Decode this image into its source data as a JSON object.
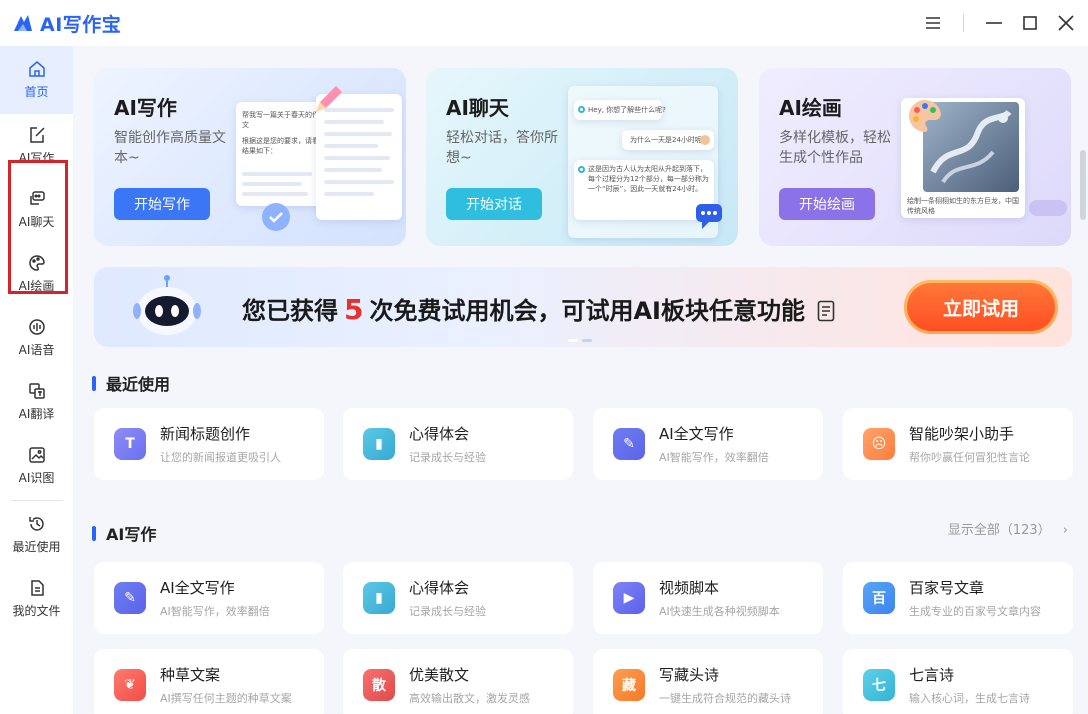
{
  "app": {
    "title": "AI写作宝"
  },
  "sidebar": {
    "items": [
      {
        "label": "首页"
      },
      {
        "label": "AI写作"
      },
      {
        "label": "AI聊天"
      },
      {
        "label": "AI绘画"
      },
      {
        "label": "AI语音"
      },
      {
        "label": "AI翻译"
      },
      {
        "label": "AI识图"
      },
      {
        "label": "最近使用"
      },
      {
        "label": "我的文件"
      }
    ]
  },
  "feature_cards": [
    {
      "title": "AI写作",
      "desc": "智能创作高质量文本~",
      "button": "开始写作",
      "mock_text_1": "帮我写一篇关于春天的作文",
      "mock_text_2": "根据这是您的要求，请看结果如下："
    },
    {
      "title": "AI聊天",
      "desc": "轻松对话，答你所想~",
      "button": "开始对话",
      "bubble_1": "Hey, 你想了解些什么呢?",
      "bubble_2": "为什么一天是24小时呢?",
      "bubble_3": "这是因为古人认为太阳从升起到落下，每个过程分为12个部分，每一部分称为一个“时辰”，因此一天就有24小时。"
    },
    {
      "title": "AI绘画",
      "desc": "多样化模板，轻松生成个性作品",
      "button": "开始绘画",
      "caption": "绘制一条栩栩如生的东方巨龙，中国传统风格"
    }
  ],
  "banner": {
    "text_before": "您已获得",
    "count": "5",
    "text_after": "次免费试用机会，可试用AI板块任意功能",
    "button": "立即试用"
  },
  "recent": {
    "heading": "最近使用",
    "items": [
      {
        "title": "新闻标题创作",
        "sub": "让您的新闻报道更吸引人",
        "icon": "news-icon",
        "glyph": "T"
      },
      {
        "title": "心得体会",
        "sub": "记录成长与经验",
        "icon": "notebook-icon",
        "glyph": "▮"
      },
      {
        "title": "AI全文写作",
        "sub": "AI智能写作，效率翻倍",
        "icon": "quill-icon",
        "glyph": "✎"
      },
      {
        "title": "智能吵架小助手",
        "sub": "帮你吵赢任何冒犯性言论",
        "icon": "angry-face-icon",
        "glyph": "☹"
      }
    ]
  },
  "ai_writing": {
    "heading": "AI写作",
    "show_all": "显示全部（123）",
    "items": [
      {
        "title": "AI全文写作",
        "sub": "AI智能写作，效率翻倍",
        "icon": "quill-icon",
        "glyph": "✎"
      },
      {
        "title": "心得体会",
        "sub": "记录成长与经验",
        "icon": "notebook-icon",
        "glyph": "▮"
      },
      {
        "title": "视频脚本",
        "sub": "AI快速生成各种视频脚本",
        "icon": "video-icon",
        "glyph": "▶"
      },
      {
        "title": "百家号文章",
        "sub": "生成专业的百家号文章内容",
        "icon": "baijia-icon",
        "glyph": "百"
      },
      {
        "title": "种草文案",
        "sub": "AI撰写任何主题的种草文案",
        "icon": "sprout-icon",
        "glyph": "❦"
      },
      {
        "title": "优美散文",
        "sub": "高效输出散文，激发灵感",
        "icon": "prose-icon",
        "glyph": "散"
      },
      {
        "title": "写藏头诗",
        "sub": "一键生成符合规范的藏头诗",
        "icon": "poem-icon",
        "glyph": "藏"
      },
      {
        "title": "七言诗",
        "sub": "输入核心词，生成七言诗",
        "icon": "seven-poem-icon",
        "glyph": "七"
      }
    ]
  },
  "colors": {
    "accent": "#2a64f6",
    "banner_button": "#ff5a2a",
    "highlight_box": "#d4242a"
  }
}
